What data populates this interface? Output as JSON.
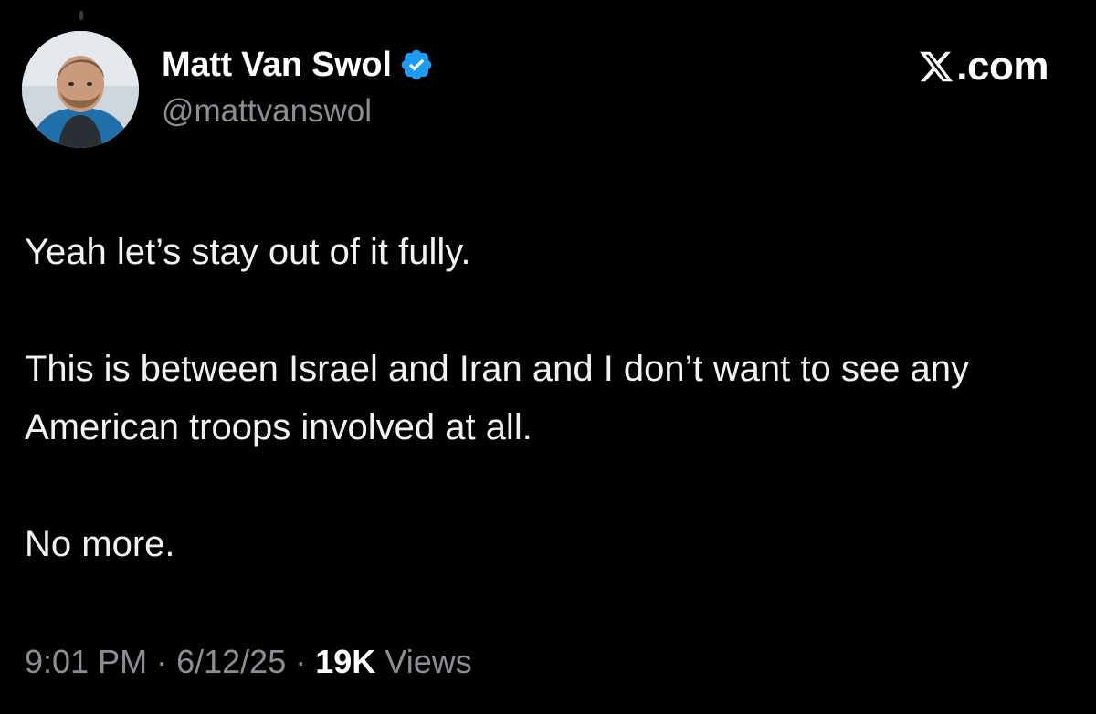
{
  "tweet": {
    "author": {
      "display_name": "Matt Van Swol",
      "handle": "@mattvanswol",
      "verified": true,
      "avatar_icon": "profile-photo"
    },
    "site_label": "com",
    "body_paragraphs": [
      "Yeah let’s stay out of it fully.",
      "This is between Israel and Iran and I don’t want to see any American troops involved at all.",
      "No more."
    ],
    "time": "9:01 PM",
    "separator": "·",
    "date": "6/12/25",
    "views_count": "19K",
    "views_label": "Views"
  },
  "colors": {
    "background": "#000000",
    "name": "#ffffff",
    "secondary_text": "#8b8f94",
    "body_text": "#f2f2f2",
    "verified_badge": "#1d9bf0"
  }
}
